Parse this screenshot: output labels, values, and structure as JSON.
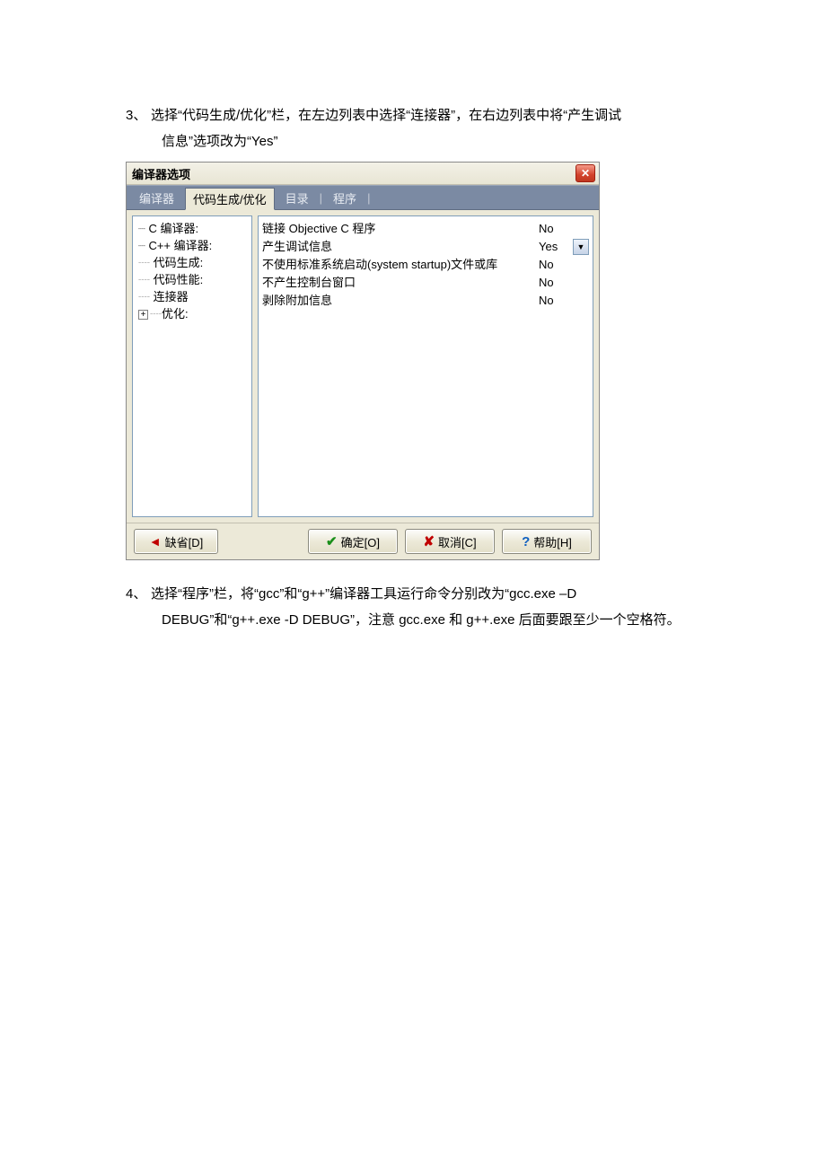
{
  "step3": {
    "number": "3、",
    "text_a": "选择“代码生成/优化”栏，在左边列表中选择“连接器”，在右边列表中将“产生调试",
    "text_b": "信息”选项改为“Yes”"
  },
  "dialog": {
    "title": "编译器选项",
    "tabs": {
      "t1": "编译器",
      "t2": "代码生成/优化",
      "t3": "目录",
      "t4": "程序"
    },
    "tree": {
      "i1": "C 编译器:",
      "i2": "C++ 编译器:",
      "i3": "代码生成:",
      "i4": "代码性能:",
      "i5": "连接器",
      "i6": "优化:"
    },
    "opts": [
      {
        "label": "链接 Objective C 程序",
        "value": "No"
      },
      {
        "label": "产生调试信息",
        "value": "Yes"
      },
      {
        "label": "不使用标准系统启动(system startup)文件或库",
        "value": "No"
      },
      {
        "label": "不产生控制台窗口",
        "value": "No"
      },
      {
        "label": "剥除附加信息",
        "value": "No"
      }
    ],
    "buttons": {
      "default": "缺省[D]",
      "ok": "确定[O]",
      "cancel": "取消[C]",
      "help": "帮助[H]"
    }
  },
  "step4": {
    "number": "4、",
    "text_a": "选择“程序”栏，将“gcc”和“g++”编译器工具运行命令分别改为“gcc.exe –D",
    "text_b": "DEBUG”和“g++.exe -D DEBUG”，注意 gcc.exe 和 g++.exe 后面要跟至少一个空格符。"
  }
}
